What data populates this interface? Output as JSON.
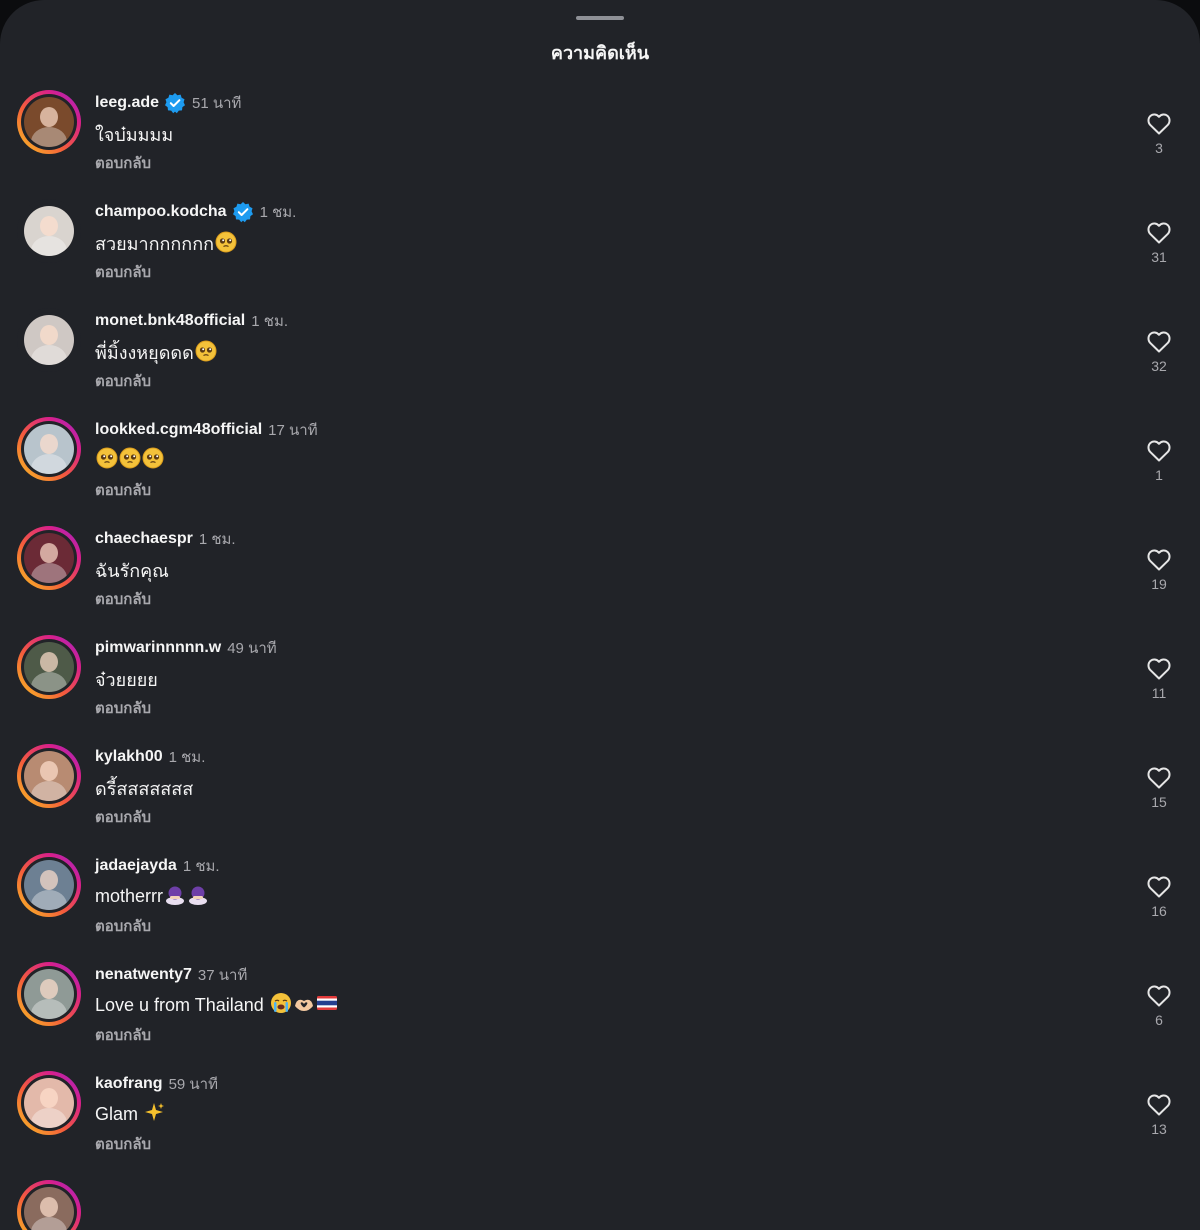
{
  "sheet": {
    "title": "ความคิดเห็น"
  },
  "reply_label": "ตอบกลับ",
  "colors": {
    "background": "#212328",
    "muted": "#a8a8ad",
    "verified": "#1d9bf0"
  },
  "comments": [
    {
      "username": "leeg.ade",
      "verified": true,
      "time": "51 นาที",
      "text": "ใจบ๋มมมม",
      "emoji": [],
      "likes": "3",
      "story_ring": true,
      "avatar_color": "#7a4a2c"
    },
    {
      "username": "champoo.kodcha",
      "verified": true,
      "time": "1 ชม.",
      "text": "สวยมากกกกกก",
      "emoji": [
        "pleading-face"
      ],
      "likes": "31",
      "story_ring": false,
      "avatar_color": "#d9d4cf"
    },
    {
      "username": "monet.bnk48official",
      "verified": false,
      "time": "1 ชม.",
      "text": "พี่มิ้งงหยุดดด",
      "emoji": [
        "pleading-face"
      ],
      "likes": "32",
      "story_ring": false,
      "avatar_color": "#cfc8c4"
    },
    {
      "username": "lookked.cgm48official",
      "verified": false,
      "time": "17 นาที",
      "text": "",
      "emoji": [
        "pleading-face",
        "pleading-face",
        "pleading-face"
      ],
      "likes": "1",
      "story_ring": true,
      "avatar_color": "#b8c4cc"
    },
    {
      "username": "chaechaespr",
      "verified": false,
      "time": "1 ชม.",
      "text": "ฉันรักคุณ",
      "emoji": [],
      "likes": "19",
      "story_ring": true,
      "avatar_color": "#6b2a36"
    },
    {
      "username": "pimwarinnnnn.w",
      "verified": false,
      "time": "49 นาที",
      "text": "จ๋วยยยย",
      "emoji": [],
      "likes": "11",
      "story_ring": true,
      "avatar_color": "#4e5a48"
    },
    {
      "username": "kylakh00",
      "verified": false,
      "time": "1 ชม.",
      "text": "ดรี้สสสสสสส",
      "emoji": [],
      "likes": "15",
      "story_ring": true,
      "avatar_color": "#b88b72"
    },
    {
      "username": "jadaejayda",
      "verified": false,
      "time": "1 ชม.",
      "text": "motherrr",
      "emoji": [
        "bowing-woman",
        "bowing-woman"
      ],
      "likes": "16",
      "story_ring": true,
      "avatar_color": "#6d8093"
    },
    {
      "username": "nenatwenty7",
      "verified": false,
      "time": "37 นาที",
      "text": "Love u from Thailand ",
      "emoji": [
        "loudly-crying-face",
        "heart-hands",
        "flag-thailand"
      ],
      "likes": "6",
      "story_ring": true,
      "avatar_color": "#8f9a96"
    },
    {
      "username": "kaofrang",
      "verified": false,
      "time": "59 นาที",
      "text": "Glam ",
      "emoji": [
        "sparkles"
      ],
      "likes": "13",
      "story_ring": true,
      "avatar_color": "#e3b9aa"
    }
  ]
}
